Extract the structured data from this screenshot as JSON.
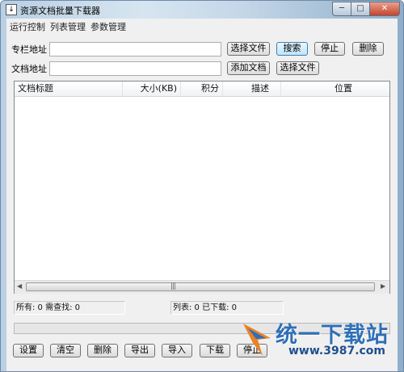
{
  "window": {
    "title": "资源文档批量下载器",
    "app_icon_glyph": "↓",
    "min_glyph": "─",
    "max_glyph": "□",
    "close_glyph": "✕"
  },
  "menu": [
    "运行控制",
    "列表管理",
    "参数管理"
  ],
  "row1": {
    "label": "专栏地址",
    "value": "",
    "buttons": [
      "选择文件",
      "搜索",
      "停止",
      "删除"
    ]
  },
  "row2": {
    "label": "文档地址",
    "value": "",
    "buttons": [
      "添加文档",
      "选择文件"
    ]
  },
  "table": {
    "columns": [
      "文档标题",
      "大小(KB)",
      "积分",
      "描述",
      "位置"
    ],
    "rows": [],
    "scroll_grip": "|||"
  },
  "status": {
    "left": "所有: 0 需查找: 0",
    "right": "列表: 0 已下载: 0"
  },
  "bottom_buttons": [
    "设置",
    "清空",
    "删除",
    "导出",
    "导入",
    "下载",
    "停止"
  ],
  "watermark": {
    "text": "统一下载站",
    "url": "www.3987.com"
  },
  "colors": {
    "title_gradient_start": "#b9cfe3",
    "close_button": "#c4452d",
    "watermark_blue": "#2e6fb7"
  }
}
